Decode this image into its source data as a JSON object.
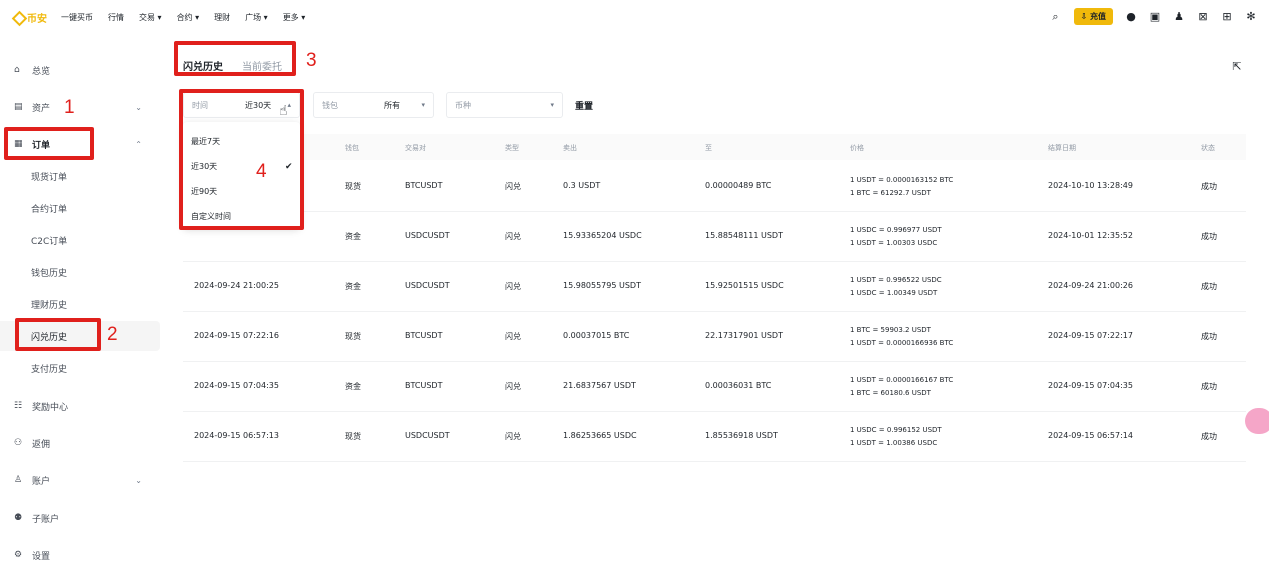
{
  "topnav": {
    "logo_text": "币安",
    "items": [
      "一键买币",
      "行情",
      "交易 ▾",
      "合约 ▾",
      "理财",
      "广场 ▾",
      "更多 ▾"
    ],
    "deposit_label": "充值"
  },
  "sidebar": {
    "overview": "总览",
    "assets": "资产",
    "orders": "订单",
    "sub_items": [
      "现货订单",
      "合约订单",
      "C2C订单",
      "钱包历史",
      "理财历史",
      "闪兑历史",
      "支付历史"
    ],
    "rewards": "奖励中心",
    "referral": "返佣",
    "account": "账户",
    "sub_account": "子账户",
    "settings": "设置"
  },
  "tabs": {
    "active": "闪兑历史",
    "inactive": "当前委托"
  },
  "filters": {
    "time_label": "时间",
    "time_value": "近30天",
    "wallet_label": "钱包",
    "wallet_value": "所有",
    "coin_label": "币种",
    "reset_label": "重置"
  },
  "dropdown": {
    "options": [
      "最近7天",
      "近30天",
      "近90天",
      "自定义时间"
    ],
    "selected": "近30天"
  },
  "table": {
    "headers": [
      "钱包",
      "交易对",
      "类型",
      "卖出",
      "至",
      "价格",
      "结算日期",
      "状态"
    ],
    "rows": [
      {
        "date": "",
        "wallet": "现货",
        "pair": "BTCUSDT",
        "type": "闪兑",
        "sell": "0.3 USDT",
        "to": "0.00000489 BTC",
        "price1": "1 USDT = 0.0000163152 BTC",
        "price2": "1 BTC = 61292.7 USDT",
        "settle": "2024-10-10 13:28:49",
        "status": "成功"
      },
      {
        "date": "",
        "wallet": "资金",
        "pair": "USDCUSDT",
        "type": "闪兑",
        "sell": "15.93365204 USDC",
        "to": "15.88548111 USDT",
        "price1": "1 USDC = 0.996977 USDT",
        "price2": "1 USDT = 1.00303 USDC",
        "settle": "2024-10-01 12:35:52",
        "status": "成功"
      },
      {
        "date": "2024-09-24 21:00:25",
        "wallet": "资金",
        "pair": "USDCUSDT",
        "type": "闪兑",
        "sell": "15.98055795 USDT",
        "to": "15.92501515 USDC",
        "price1": "1 USDT = 0.996522 USDC",
        "price2": "1 USDC = 1.00349 USDT",
        "settle": "2024-09-24 21:00:26",
        "status": "成功"
      },
      {
        "date": "2024-09-15 07:22:16",
        "wallet": "现货",
        "pair": "BTCUSDT",
        "type": "闪兑",
        "sell": "0.00037015 BTC",
        "to": "22.17317901 USDT",
        "price1": "1 BTC = 59903.2 USDT",
        "price2": "1 USDT = 0.0000166936 BTC",
        "settle": "2024-09-15 07:22:17",
        "status": "成功"
      },
      {
        "date": "2024-09-15 07:04:35",
        "wallet": "资金",
        "pair": "BTCUSDT",
        "type": "闪兑",
        "sell": "21.6837567 USDT",
        "to": "0.00036031 BTC",
        "price1": "1 USDT = 0.0000166167 BTC",
        "price2": "1 BTC = 60180.6 USDT",
        "settle": "2024-09-15 07:04:35",
        "status": "成功"
      },
      {
        "date": "2024-09-15 06:57:13",
        "wallet": "现货",
        "pair": "USDCUSDT",
        "type": "闪兑",
        "sell": "1.86253665 USDC",
        "to": "1.85536918 USDT",
        "price1": "1 USDC = 0.996152 USDT",
        "price2": "1 USDT = 1.00386 USDC",
        "settle": "2024-09-15 06:57:14",
        "status": "成功"
      }
    ]
  },
  "annotations": [
    "1",
    "2",
    "3",
    "4"
  ],
  "colors": {
    "brand": "#f0b90b",
    "annotation": "#e0201c"
  }
}
